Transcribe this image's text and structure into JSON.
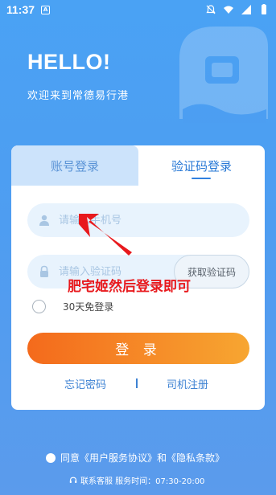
{
  "status_bar": {
    "time": "11:37",
    "app_badge": "A",
    "icons": [
      "bell-off-icon",
      "wifi-icon",
      "signal-icon",
      "battery-icon"
    ]
  },
  "header": {
    "title": "HELLO!",
    "subtitle": "欢迎来到常德易行港"
  },
  "login": {
    "tabs": [
      {
        "label": "账号登录",
        "active": false
      },
      {
        "label": "验证码登录",
        "active": true
      }
    ],
    "phone": {
      "placeholder": "请输入手机号",
      "icon": "user-icon"
    },
    "code": {
      "placeholder": "请输入验证码",
      "icon": "lock-icon",
      "get_code_label": "获取验证码"
    },
    "remember_label": "30天免登录",
    "submit_label": "登 录",
    "forgot_label": "忘记密码",
    "separator": "I",
    "register_label": "司机注册"
  },
  "annotation": {
    "text": "肥宅姬然后登录即可",
    "color": "#e8191d"
  },
  "footer": {
    "agreement": "同意《用户服务协议》和《隐私条款》",
    "service": "联系客服 服务时间：07:30-20:00"
  },
  "colors": {
    "background": "#4e9df1",
    "accent": "#2f80e0",
    "login_gradient_start": "#f46a1c",
    "login_gradient_end": "#f7a631"
  }
}
